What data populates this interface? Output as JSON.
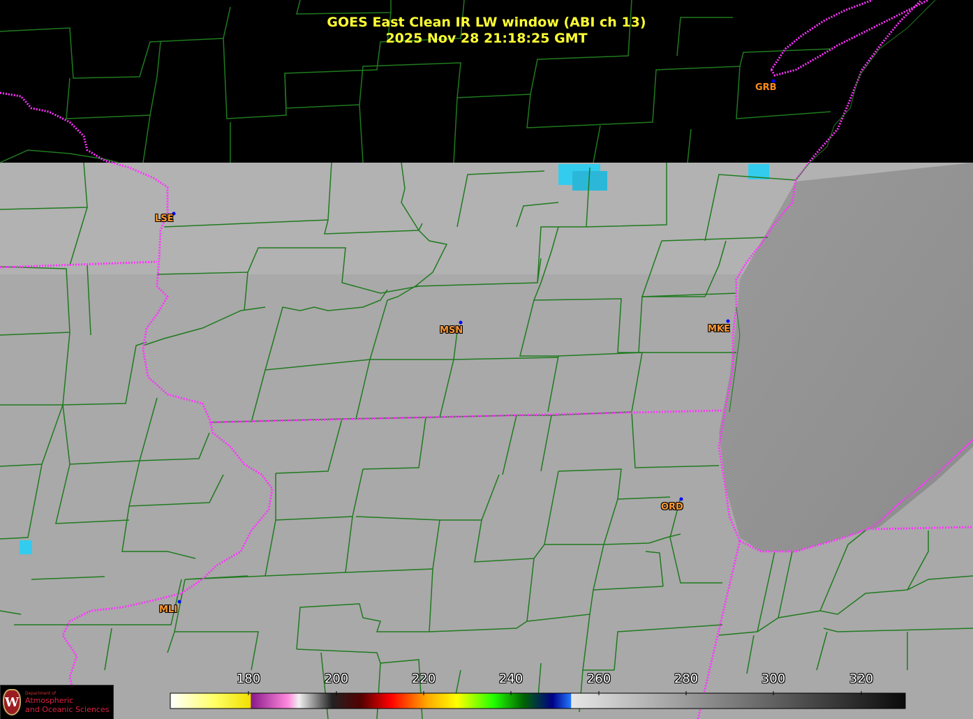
{
  "header": {
    "title_line1": "GOES East Clean IR LW window (ABI ch 13)",
    "title_line2": "2025 Nov 28  21:18:25 GMT"
  },
  "stations": [
    {
      "code": "GRB"
    },
    {
      "code": "LSE"
    },
    {
      "code": "MSN"
    },
    {
      "code": "MKE"
    },
    {
      "code": "ORD"
    },
    {
      "code": "MLI"
    }
  ],
  "colorbar": {
    "unit_hint": "brightness temperature",
    "ticks": [
      "180",
      "200",
      "220",
      "240",
      "260",
      "280",
      "300",
      "320"
    ]
  },
  "logo": {
    "dept_line": "Department of",
    "name_line1": "Atmospheric",
    "name_line2": "and Oceanic Sciences",
    "seal_letter": "W"
  },
  "colors": {
    "county_lines": "#1f7a1f",
    "state_borders": "#ff33ff",
    "title_text": "#ffff33",
    "station_label": "#ff9933",
    "station_dot": "#0000ff",
    "cold_cloud": "#33ccee",
    "background_no_data": "#000000"
  }
}
